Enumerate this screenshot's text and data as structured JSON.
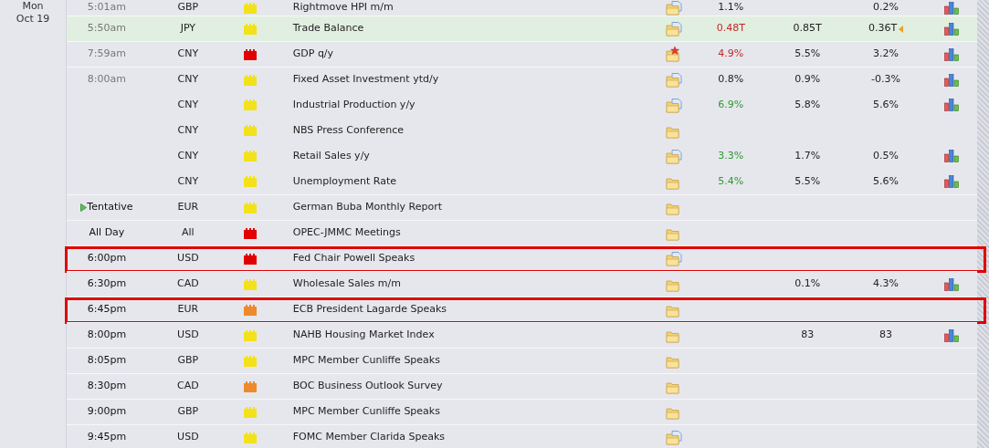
{
  "day": {
    "weekday": "Mon",
    "date": "Oct 19"
  },
  "rows": [
    {
      "time": "5:01am",
      "past": true,
      "currency": "GBP",
      "impact": {
        "color": "#f3e11b"
      },
      "event": "Rightmove HPI m/m",
      "has_document": true,
      "actual": {
        "text": "1.1%",
        "color": "#222222"
      },
      "previous": "0.2%",
      "chart": true
    },
    {
      "time": "5:50am",
      "past": true,
      "currency": "JPY",
      "impact": {
        "color": "#f3e11b"
      },
      "event": "Trade Balance",
      "has_document": true,
      "actual": {
        "text": "0.48T",
        "color": "#c0282a"
      },
      "forecast": "0.85T",
      "previous": "0.36T",
      "revised": true,
      "chart": true,
      "highlighted": true
    },
    {
      "time": "7:59am",
      "past": true,
      "currency": "CNY",
      "impact": {
        "color": "#e00000"
      },
      "event": "GDP q/y",
      "starred": true,
      "actual": {
        "text": "4.9%",
        "color": "#c0282a"
      },
      "forecast": "5.5%",
      "previous": "3.2%",
      "chart": true
    },
    {
      "time": "8:00am",
      "past": true,
      "currency": "CNY",
      "impact": {
        "color": "#f3e11b"
      },
      "event": "Fixed Asset Investment ytd/y",
      "has_document": true,
      "actual": {
        "text": "0.8%",
        "color": "#222222"
      },
      "forecast": "0.9%",
      "previous": "-0.3%",
      "chart": true
    },
    {
      "currency": "CNY",
      "impact": {
        "color": "#f3e11b"
      },
      "event": "Industrial Production y/y",
      "has_document": true,
      "actual": {
        "text": "6.9%",
        "color": "#2e9a2e"
      },
      "forecast": "5.8%",
      "previous": "5.6%",
      "chart": true
    },
    {
      "currency": "CNY",
      "impact": {
        "color": "#f3e11b"
      },
      "event": "NBS Press Conference"
    },
    {
      "currency": "CNY",
      "impact": {
        "color": "#f3e11b"
      },
      "event": "Retail Sales y/y",
      "has_document": true,
      "actual": {
        "text": "3.3%",
        "color": "#2e9a2e"
      },
      "forecast": "1.7%",
      "previous": "0.5%",
      "chart": true
    },
    {
      "currency": "CNY",
      "impact": {
        "color": "#f3e11b"
      },
      "event": "Unemployment Rate",
      "actual": {
        "text": "5.4%",
        "color": "#2e9a2e"
      },
      "forecast": "5.5%",
      "previous": "5.6%",
      "chart": true
    },
    {
      "time": "Tentative",
      "past": false,
      "currency": "EUR",
      "impact": {
        "color": "#f3e11b"
      },
      "event": "German Buba Monthly Report",
      "tentative": true
    },
    {
      "time": "All Day",
      "past": false,
      "currency": "All",
      "impact": {
        "color": "#e00000"
      },
      "event": "OPEC-JMMC Meetings"
    },
    {
      "time": "6:00pm",
      "past": false,
      "currency": "USD",
      "impact": {
        "color": "#e00000"
      },
      "event": "Fed Chair Powell Speaks",
      "has_document": true,
      "outlined": true
    },
    {
      "time": "6:30pm",
      "past": false,
      "currency": "CAD",
      "impact": {
        "color": "#f3e11b"
      },
      "event": "Wholesale Sales m/m",
      "forecast": "0.1%",
      "previous": "4.3%",
      "chart": true
    },
    {
      "time": "6:45pm",
      "past": false,
      "currency": "EUR",
      "impact": {
        "color": "#ee8a2c"
      },
      "event": "ECB President Lagarde Speaks",
      "outlined": true
    },
    {
      "time": "8:00pm",
      "past": false,
      "currency": "USD",
      "impact": {
        "color": "#f3e11b"
      },
      "event": "NAHB Housing Market Index",
      "forecast": "83",
      "previous": "83",
      "chart": true
    },
    {
      "time": "8:05pm",
      "past": false,
      "currency": "GBP",
      "impact": {
        "color": "#f3e11b"
      },
      "event": "MPC Member Cunliffe Speaks"
    },
    {
      "time": "8:30pm",
      "past": false,
      "currency": "CAD",
      "impact": {
        "color": "#ee8a2c"
      },
      "event": "BOC Business Outlook Survey"
    },
    {
      "time": "9:00pm",
      "past": false,
      "currency": "GBP",
      "impact": {
        "color": "#f3e11b"
      },
      "event": "MPC Member Cunliffe Speaks"
    },
    {
      "time": "9:45pm",
      "past": false,
      "currency": "USD",
      "impact": {
        "color": "#f3e11b"
      },
      "event": "FOMC Member Clarida Speaks",
      "has_document": true
    }
  ]
}
